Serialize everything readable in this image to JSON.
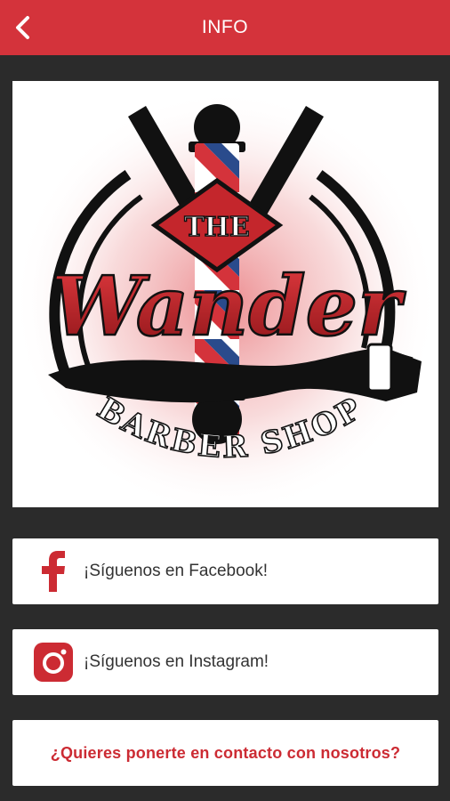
{
  "header": {
    "title": "INFO",
    "back_icon": "chevron-left-icon",
    "background": "#d4333b"
  },
  "logo": {
    "brand_top": "THE",
    "brand_main": "Wander",
    "brand_sub": "BARBER SHOP"
  },
  "links": [
    {
      "icon": "facebook-icon",
      "label": "¡Síguenos en Facebook!"
    },
    {
      "icon": "instagram-icon",
      "label": "¡Síguenos en Instagram!"
    }
  ],
  "contact": {
    "label": "¿Quieres ponerte en contacto con nosotros?",
    "color": "#cc2b33"
  }
}
